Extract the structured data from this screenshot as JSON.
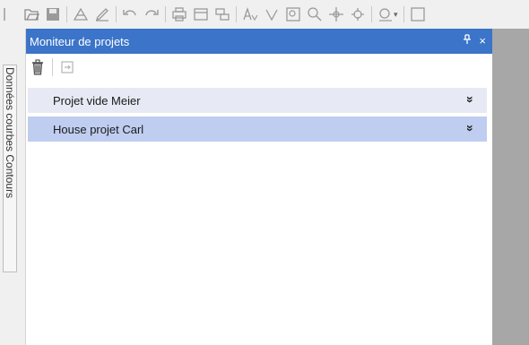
{
  "panel": {
    "title": "Moniteur de projets",
    "pin_glyph": "ᵼ",
    "close_glyph": "×"
  },
  "side_tab": {
    "label": "Données courbes Contours"
  },
  "projects": [
    {
      "name": "Projet vide Meier",
      "selected": false
    },
    {
      "name": "House projet Carl",
      "selected": true
    }
  ],
  "chevron_glyph": "»",
  "icons": {
    "toolbar": [
      "new-doc-icon",
      "save-icon",
      "draw-icon",
      "pencil-icon",
      "undo-icon",
      "redo-icon",
      "print-icon",
      "layout-icon",
      "page-setup-icon",
      "text-style-icon",
      "fx-icon",
      "zoom-window-icon",
      "zoom-icon",
      "pan-icon",
      "target-icon",
      "measure-icon",
      "more-icon"
    ],
    "panel_toolbar": [
      "trash-icon",
      "export-icon"
    ]
  },
  "colors": {
    "title_bar": "#3b74c8",
    "row_default": "#e7e9f4",
    "row_selected": "#bfcdf0",
    "right_area": "#a7a7a7"
  }
}
